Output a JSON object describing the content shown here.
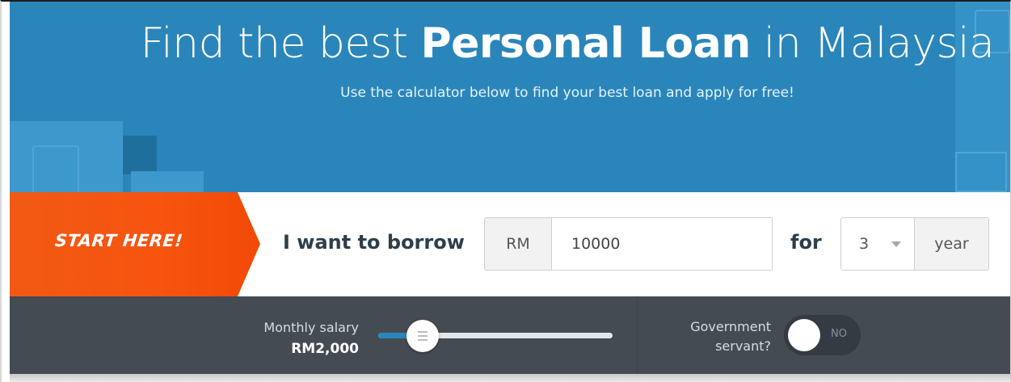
{
  "hero": {
    "title_pre": "Find the best ",
    "title_bold": "Personal Loan",
    "title_post": " in Malaysia",
    "subtitle": "Use the calculator below to find your best loan and apply for free!"
  },
  "banner": {
    "label": "START HERE!"
  },
  "borrow": {
    "label": "I want to borrow",
    "currency": "RM",
    "amount": "10000",
    "for_label": "for",
    "tenure_value": "3",
    "tenure_unit": "year"
  },
  "filters": {
    "salary_label": "Monthly salary",
    "salary_value": "RM2,000",
    "salary_fraction": 0.19,
    "gov_label_line1": "Government",
    "gov_label_line2": "servant?",
    "gov_toggle_text": "NO"
  },
  "colors": {
    "hero_blue": "#2a86ba",
    "banner_orange": "#f25a14",
    "bar_dark": "#444b53",
    "heading_text": "#2e3e4a"
  }
}
